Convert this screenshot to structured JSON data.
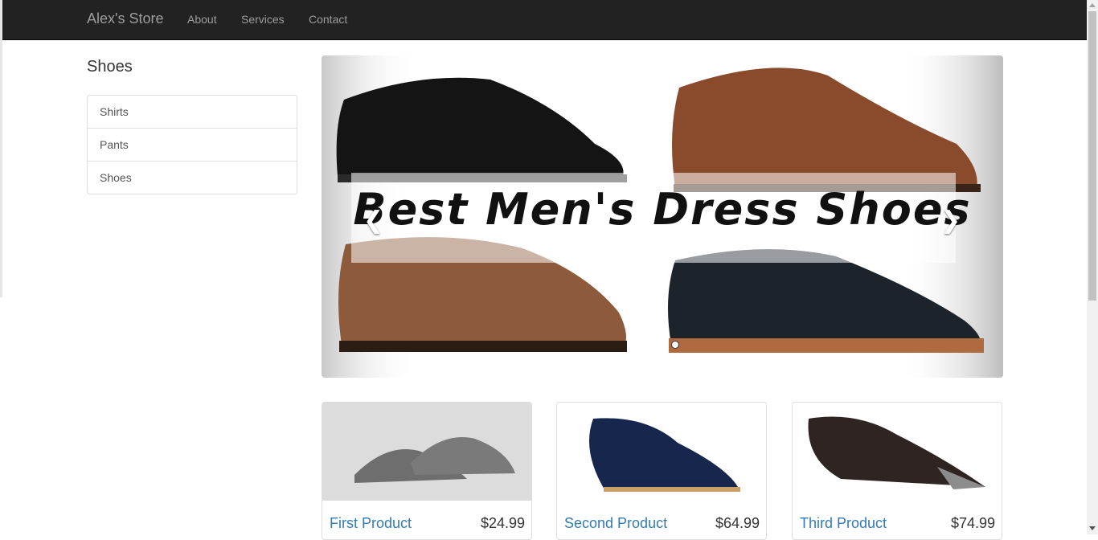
{
  "navbar": {
    "brand": "Alex's Store",
    "links": [
      "About",
      "Services",
      "Contact"
    ]
  },
  "sidebar": {
    "title": "Shoes",
    "items": [
      "Shirts",
      "Pants",
      "Shoes"
    ]
  },
  "carousel": {
    "caption": "Best Men's Dress Shoes",
    "prev_icon": "chevron-left-icon",
    "next_icon": "chevron-right-icon"
  },
  "products": [
    {
      "name": "First Product",
      "price": "$24.99"
    },
    {
      "name": "Second Product",
      "price": "$64.99"
    },
    {
      "name": "Third Product",
      "price": "$74.99"
    }
  ],
  "colors": {
    "navbar_bg": "#222222",
    "link": "#337ab7"
  }
}
